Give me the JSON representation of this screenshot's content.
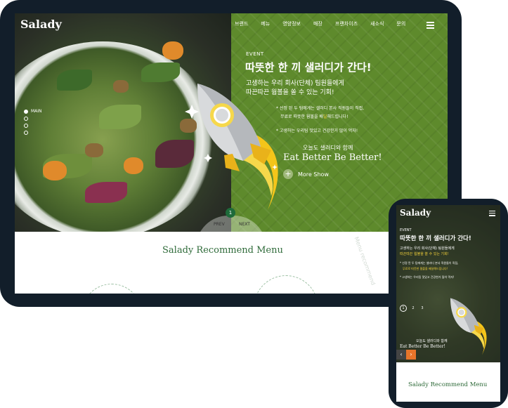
{
  "tablet": {
    "logo": "Salady",
    "nav": [
      "브랜드",
      "메뉴",
      "영양정보",
      "매장",
      "프랜차이즈",
      "새소식",
      "문의"
    ],
    "slide_indicator": {
      "active_label": "MAIN",
      "count": 4
    },
    "event": {
      "tag": "EVENT",
      "title": "따뜻한 한 끼 샐러디가 간다!",
      "subtitle_line1": "고생하는 우리 회사(단체) 팀원들에게",
      "subtitle_line2": "따끈따끈 웜볼을 쏠 수 있는 기회!",
      "notes": [
        {
          "a": "* 선정 된 두 팀에게는 샐러디 본사 직원들이 직접,",
          "b": ""
        },
        {
          "a": "무료로 따뜻한 웜볼을 배",
          "b": "달",
          "c": "해드립니다!"
        },
        {
          "a": "* 고생하는 우리팀 맛있고 건강한거 많이 먹자!",
          "b": ""
        }
      ],
      "tagline": "오늘도 샐러디와 함께",
      "slogan": "Eat Better Be Better!",
      "more_label": "More Show"
    },
    "pager": {
      "number": "1",
      "prev": "PREV",
      "next": "NEXT"
    },
    "recommend_title": "Salady Recommend Menu",
    "vertical_text": "Menu recommend"
  },
  "phone": {
    "logo": "Salady",
    "event_tag": "EVENT",
    "title": "따뜻한 한 끼 샐러디가 간다!",
    "subtitle_line1": "고생하는 우리 회사(단체) 팀원들에게",
    "subtitle_line2": "따끈따끈 웜볼을 쏠 수 있는 기회!",
    "note1": "* 선정 된 두 팀에게는 샐러디 본사 직원들이 직접,",
    "note2": "무료로 따뜻한 웜볼을 배달해드립니다!",
    "note3": "* 고생하는 우리팀 맛있고 건강한거 많이 먹자!",
    "slides": [
      "1",
      "2",
      "3"
    ],
    "tagline": "오늘도 샐러디와 함께",
    "slogan": "Eat Better Be Better!",
    "prev_arrow": "‹",
    "next_arrow": "›",
    "recommend_title": "Salady Recommend Menu"
  },
  "colors": {
    "brand_green": "#5e8a2c",
    "accent_yellow": "#f4d33a",
    "accent_orange": "#e8742a",
    "title_green": "#2f6b3a",
    "frame": "#121e2a"
  }
}
